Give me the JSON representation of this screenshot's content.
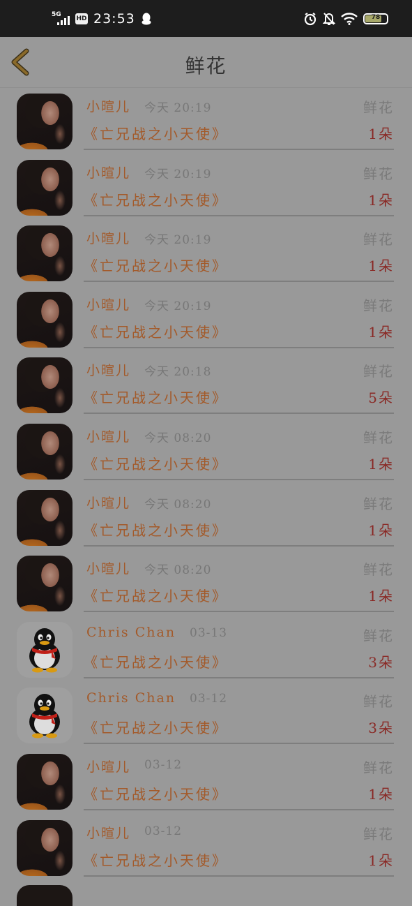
{
  "status_bar": {
    "network": "5G",
    "hd": "HD",
    "time": "23:53",
    "battery": "78",
    "battery_level": 0.78
  },
  "header": {
    "title": "鲜花"
  },
  "list": [
    {
      "name": "小暄儿",
      "time": "今天 20:19",
      "gift": "鲜花",
      "book": "《亡兄战之小天使》",
      "count": "1朵",
      "avatar": "photo"
    },
    {
      "name": "小暄儿",
      "time": "今天 20:19",
      "gift": "鲜花",
      "book": "《亡兄战之小天使》",
      "count": "1朵",
      "avatar": "photo"
    },
    {
      "name": "小暄儿",
      "time": "今天 20:19",
      "gift": "鲜花",
      "book": "《亡兄战之小天使》",
      "count": "1朵",
      "avatar": "photo"
    },
    {
      "name": "小暄儿",
      "time": "今天 20:19",
      "gift": "鲜花",
      "book": "《亡兄战之小天使》",
      "count": "1朵",
      "avatar": "photo"
    },
    {
      "name": "小暄儿",
      "time": "今天 20:18",
      "gift": "鲜花",
      "book": "《亡兄战之小天使》",
      "count": "5朵",
      "avatar": "photo"
    },
    {
      "name": "小暄儿",
      "time": "今天 08:20",
      "gift": "鲜花",
      "book": "《亡兄战之小天使》",
      "count": "1朵",
      "avatar": "photo"
    },
    {
      "name": "小暄儿",
      "time": "今天 08:20",
      "gift": "鲜花",
      "book": "《亡兄战之小天使》",
      "count": "1朵",
      "avatar": "photo"
    },
    {
      "name": "小暄儿",
      "time": "今天 08:20",
      "gift": "鲜花",
      "book": "《亡兄战之小天使》",
      "count": "1朵",
      "avatar": "photo"
    },
    {
      "name": "Chris Chan",
      "time": "03-13",
      "gift": "鲜花",
      "book": "《亡兄战之小天使》",
      "count": "3朵",
      "avatar": "qq"
    },
    {
      "name": "Chris Chan",
      "time": "03-12",
      "gift": "鲜花",
      "book": "《亡兄战之小天使》",
      "count": "3朵",
      "avatar": "qq"
    },
    {
      "name": "小暄儿",
      "time": "03-12",
      "gift": "鲜花",
      "book": "《亡兄战之小天使》",
      "count": "1朵",
      "avatar": "photo"
    },
    {
      "name": "小暄儿",
      "time": "03-12",
      "gift": "鲜花",
      "book": "《亡兄战之小天使》",
      "count": "1朵",
      "avatar": "photo"
    }
  ],
  "colors": {
    "overlay_bg": "#999999",
    "name": "#a35a2a",
    "count": "#8a2a26",
    "back_arrow": "#8a6a2a"
  },
  "icons": {
    "back": "chevron-left-icon",
    "qq": "qq-penguin-icon",
    "alarm": "alarm-icon",
    "mute": "bell-off-icon",
    "wifi": "wifi-icon"
  }
}
